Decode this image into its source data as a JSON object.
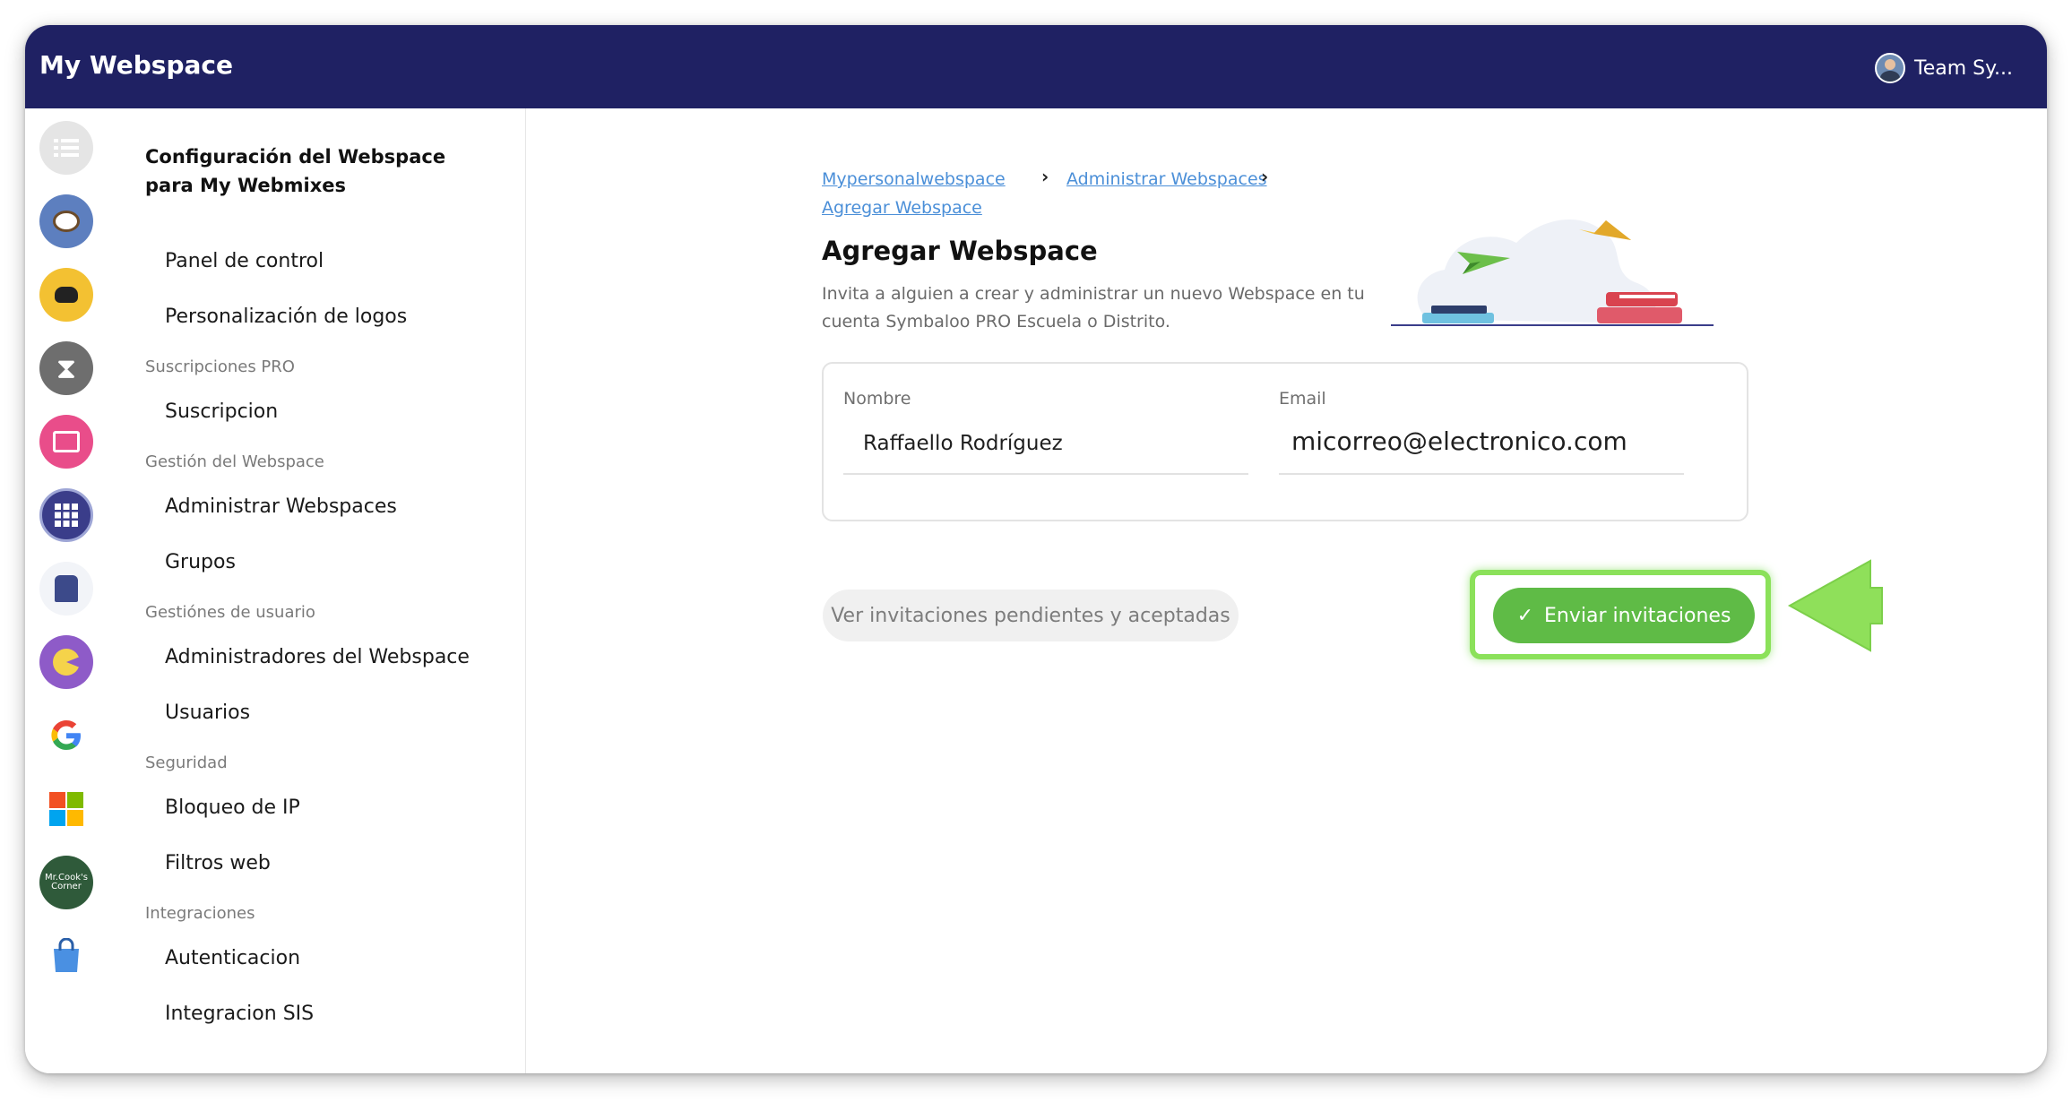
{
  "app": {
    "title": "My Webspace",
    "user_name": "Team Sy..."
  },
  "iconbar": {
    "icons": [
      "list-icon",
      "owl-icon",
      "cat-icon",
      "hourglass-icon",
      "presentation-icon",
      "grid-icon",
      "graduates-icon",
      "pacman-icon",
      "google-icon",
      "microsoft-icon",
      "cooks-corner-icon",
      "shopping-bag-icon"
    ],
    "cook_label": "Mr.Cook's Corner"
  },
  "nav": {
    "title": "Configuración del Webspace para My Webmixes",
    "items": {
      "panel": "Panel de control",
      "logos": "Personalización de logos",
      "sec_pro": "Suscripciones PRO",
      "suscripcion": "Suscripcion",
      "sec_gestion": "Gestión del Webspace",
      "admin_ws": "Administrar Webspaces",
      "grupos": "Grupos",
      "sec_usuario": "Gestiónes de usuario",
      "admins": "Administradores del Webspace",
      "usuarios": "Usuarios",
      "sec_seguridad": "Seguridad",
      "ip": "Bloqueo de IP",
      "filtros": "Filtros web",
      "sec_integraciones": "Integraciones",
      "auth": "Autenticacion",
      "sis": "Integracion SIS"
    }
  },
  "breadcrumb": [
    "Mypersonalwebspace",
    "Administrar Webspaces",
    "Agregar Webspace"
  ],
  "main": {
    "title": "Agregar Webspace",
    "description": "Invita a alguien a crear y administrar un nuevo Webspace en tu cuenta Symbaloo PRO Escuela o Distrito."
  },
  "form": {
    "name_label": "Nombre",
    "name_value": "Raffaello Rodríguez",
    "email_label": "Email",
    "email_value": "micorreo@electronico.com"
  },
  "actions": {
    "pending": "Ver invitaciones pendientes y aceptadas",
    "send": "Enviar invitaciones"
  },
  "colors": {
    "topbar": "#1f2163",
    "accent_green": "#5fbb46",
    "highlight": "#8be15a",
    "link": "#4b8fd8"
  }
}
